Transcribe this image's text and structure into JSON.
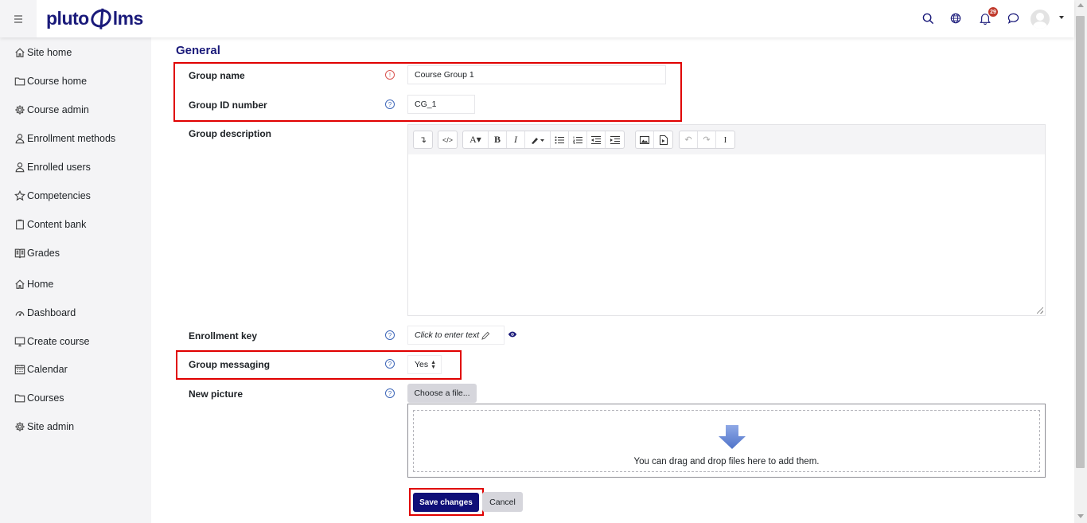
{
  "brand": {
    "logo_prefix": "pluto",
    "logo_suffix": "lms"
  },
  "header": {
    "icons": [
      "hamburger-icon",
      "search-icon",
      "globe-icon",
      "bell-icon",
      "chat-icon",
      "avatar",
      "chevron-down-icon"
    ],
    "notification_count": "29"
  },
  "sidebar": {
    "items": [
      {
        "label": "Site home",
        "icon": "home-icon"
      },
      {
        "label": "Course home",
        "icon": "folder-icon"
      },
      {
        "label": "Course admin",
        "icon": "gear-icon"
      },
      {
        "label": "Enrollment methods",
        "icon": "user-icon"
      },
      {
        "label": "Enrolled users",
        "icon": "user-icon"
      },
      {
        "label": "Competencies",
        "icon": "star-icon"
      },
      {
        "label": "Content bank",
        "icon": "clipboard-icon"
      },
      {
        "label": "Grades",
        "icon": "book-icon"
      },
      {
        "label": "Home",
        "icon": "home-icon"
      },
      {
        "label": "Dashboard",
        "icon": "dashboard-icon"
      },
      {
        "label": "Create course",
        "icon": "monitor-icon"
      },
      {
        "label": "Calendar",
        "icon": "calendar-icon"
      },
      {
        "label": "Courses",
        "icon": "folder-icon"
      },
      {
        "label": "Site admin",
        "icon": "gear-icon"
      }
    ]
  },
  "form": {
    "section_title": "General",
    "group_name": {
      "label": "Group name",
      "value": "Course Group 1"
    },
    "group_id": {
      "label": "Group ID number",
      "value": "CG_1"
    },
    "group_description": {
      "label": "Group description"
    },
    "enrollment_key": {
      "label": "Enrollment key",
      "value": "Click to enter text"
    },
    "group_messaging": {
      "label": "Group messaging",
      "value": "Yes"
    },
    "new_picture": {
      "label": "New picture",
      "button": "Choose a file...",
      "dropzone_text": "You can drag and drop files here to add them."
    },
    "save_label": "Save changes",
    "cancel_label": "Cancel"
  },
  "colors": {
    "brand": "#1a1a7a",
    "highlight": "#e00000",
    "primary_button": "#0f0f78",
    "sidebar_bg": "#f4f4f6"
  }
}
